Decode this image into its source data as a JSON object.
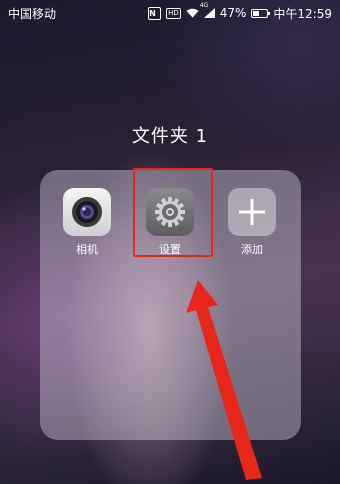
{
  "status_bar": {
    "carrier": "中国移动",
    "network": "4G",
    "battery_percent": "47%",
    "battery_level": 0.47,
    "time": "中午12:59"
  },
  "folder": {
    "title": "文件夹 1",
    "apps": [
      {
        "label": "相机",
        "icon": "camera-icon"
      },
      {
        "label": "设置",
        "icon": "gear-icon"
      },
      {
        "label": "添加",
        "icon": "plus-icon"
      }
    ]
  },
  "annotation": {
    "highlight_color": "#e8261b",
    "arrow_color": "#e8261b"
  }
}
